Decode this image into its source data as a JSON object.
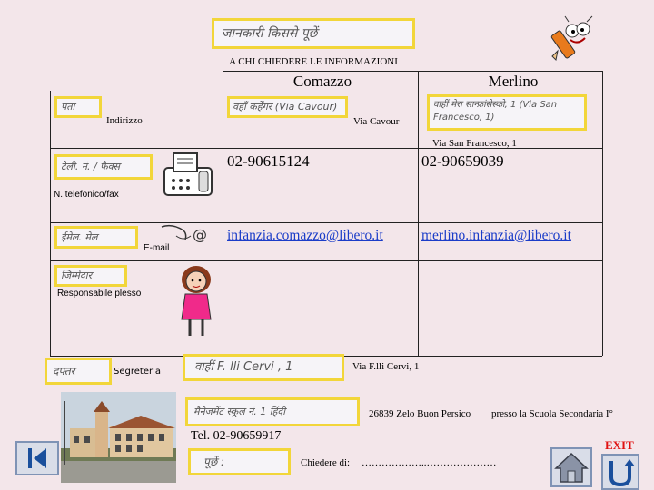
{
  "header": {
    "handwritten_title": "जानकारी किससे पूछें",
    "title": "A CHI CHIEDERE LE INFORMAZIONI"
  },
  "columns": {
    "comazzo": "Comazzo",
    "merlino": "Merlino"
  },
  "indirizzo": {
    "handwritten_label": "पता",
    "label": "Indirizzo",
    "comazzo_handwritten": "वहाँ कहेंगर (Via Cavour)",
    "comazzo_value": "Via Cavour",
    "merlino_handwritten": "वाहीं मेरा सान्फ्रांसेस्को, 1 (Via San Francesco, 1)",
    "merlino_value": "Via San Francesco, 1"
  },
  "telefono": {
    "handwritten_label": "टेली. नं. / फैक्स",
    "label": "N. telefonico/fax",
    "comazzo_value": "02-90615124",
    "merlino_value": "02-90659039"
  },
  "email": {
    "handwritten_label": "ईमेल. मेल",
    "label": "E-mail",
    "comazzo_value": "infanzia.comazzo@libero.it",
    "merlino_value": "merlino.infanzia@libero.it"
  },
  "responsabile": {
    "handwritten_label": "जिम्मेदार",
    "label": "Responsabile plesso"
  },
  "segreteria": {
    "handwritten_label": "दफ्तर",
    "label": "Segreteria",
    "address_handwritten": "वाहीं F. lli Cervi , 1",
    "address": "Via F.lli Cervi, 1",
    "city_handwritten": "मैनेजमेंट स्कूल नं. 1 हिंदी",
    "city": "26839 Zelo Buon Persico",
    "presso": "presso la Scuola Secondaria I°",
    "tel": "Tel. 02-90659917",
    "ask_handwritten": "पूछें :",
    "ask_label": "Chiedere di:",
    "ask_dots": "………………..…………………"
  },
  "nav": {
    "exit_label": "EXIT"
  },
  "colors": {
    "highlight_border": "#f2d63a",
    "exit_red": "#e01010",
    "nav_blue": "#1a4f9c"
  }
}
